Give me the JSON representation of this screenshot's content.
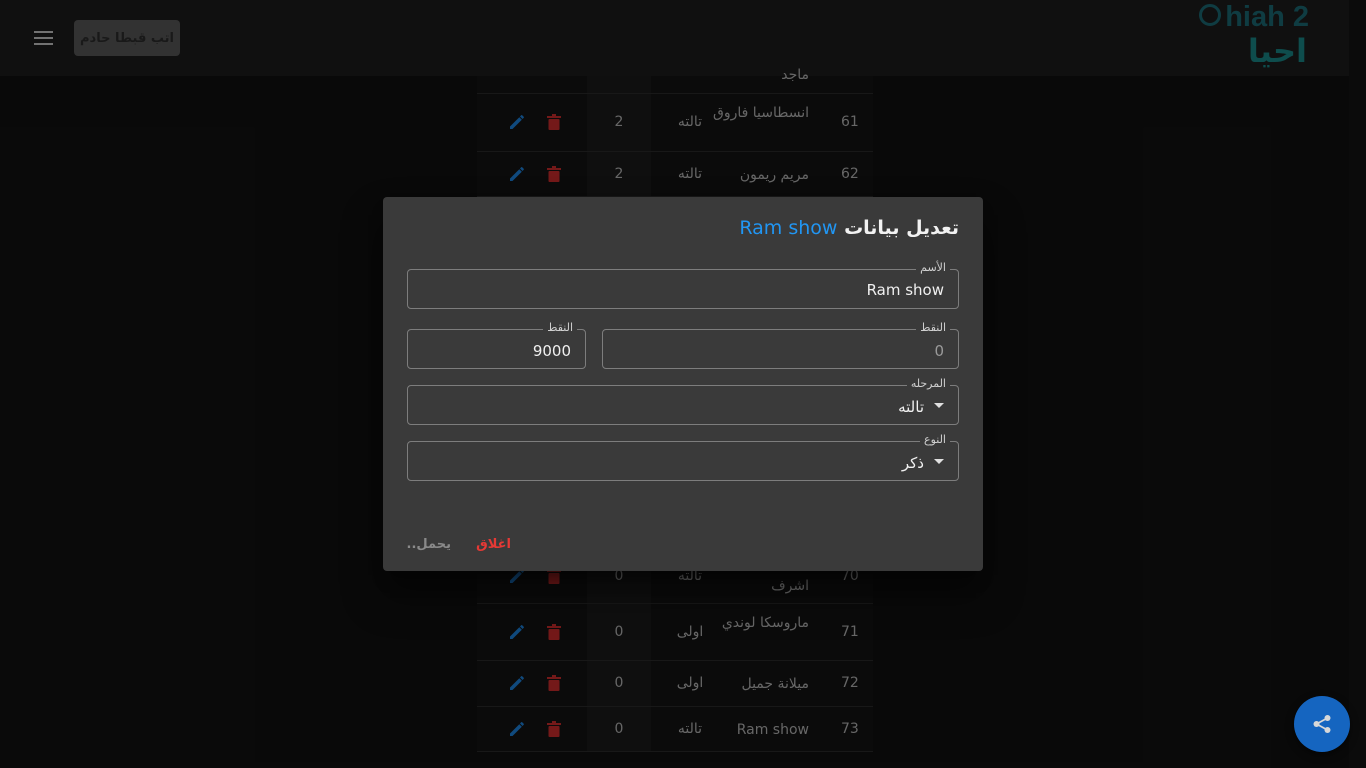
{
  "appbar": {
    "add_button_label": "اتب قبطا حادم",
    "logo_text_en": "hiah 2",
    "logo_text_ar": "احيا"
  },
  "table": {
    "rows": [
      {
        "num": "",
        "name": "ماجد",
        "stage": "",
        "points": ""
      },
      {
        "num": "61",
        "name": "انسطاسيا فاروق",
        "stage": "تالته",
        "points": "2"
      },
      {
        "num": "62",
        "name": "مريم ريمون",
        "stage": "تالته",
        "points": "2"
      },
      {
        "num": "70",
        "name": "اشرف",
        "stage": "تالته",
        "points": "0"
      },
      {
        "num": "71",
        "name": "ماروسكا لوندي",
        "stage": "اولى",
        "points": "0"
      },
      {
        "num": "72",
        "name": "ميلانة جميل",
        "stage": "اولى",
        "points": "0"
      },
      {
        "num": "73",
        "name": "Ram show",
        "stage": "تالته",
        "points": "0"
      }
    ]
  },
  "dialog": {
    "title_prefix": "تعديل بيانات",
    "title_name": "Ram show",
    "name_field": {
      "label": "الأسم",
      "value": "Ram show"
    },
    "points_field_a": {
      "label": "النقط",
      "value": "0"
    },
    "points_field_b": {
      "label": "النقط",
      "value": "9000"
    },
    "stage_field": {
      "label": "المرحله",
      "value": "تالته"
    },
    "gender_field": {
      "label": "النوع",
      "value": "ذكر"
    },
    "close_label": "اغلاق",
    "loading_label": "يحمل.."
  },
  "colors": {
    "accent": "#2196f3",
    "danger": "#e53935",
    "fab": "#1565c0"
  }
}
